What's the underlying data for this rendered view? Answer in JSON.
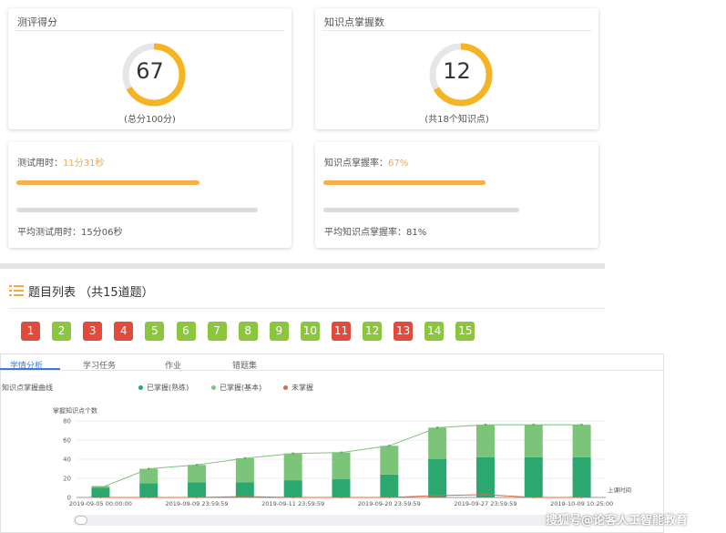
{
  "score_card": {
    "title": "测评得分",
    "value": "67",
    "sub": "(总分100分)",
    "progress": 0.67
  },
  "knowledge_card": {
    "title": "知识点掌握数",
    "value": "12",
    "sub": "(共18个知识点)",
    "progress": 0.667
  },
  "time_card": {
    "label": "测试用时：",
    "value": "11分31秒",
    "progress": 0.76,
    "avg_label": "平均测试用时：15分06秒",
    "avg_progress": 1.0
  },
  "rate_card": {
    "label": "知识点掌握率：",
    "value": "67%",
    "progress": 0.67,
    "avg_label": "平均知识点掌握率：81%",
    "avg_progress": 0.81
  },
  "question_list": {
    "title": "题目列表 （共15道题）",
    "questions": [
      {
        "n": "1",
        "status": "wrong"
      },
      {
        "n": "2",
        "status": "correct"
      },
      {
        "n": "3",
        "status": "wrong"
      },
      {
        "n": "4",
        "status": "wrong"
      },
      {
        "n": "5",
        "status": "correct"
      },
      {
        "n": "6",
        "status": "correct"
      },
      {
        "n": "7",
        "status": "correct"
      },
      {
        "n": "8",
        "status": "correct"
      },
      {
        "n": "9",
        "status": "correct"
      },
      {
        "n": "10",
        "status": "correct"
      },
      {
        "n": "11",
        "status": "wrong"
      },
      {
        "n": "12",
        "status": "correct"
      },
      {
        "n": "13",
        "status": "wrong"
      },
      {
        "n": "14",
        "status": "correct"
      },
      {
        "n": "15",
        "status": "correct"
      }
    ]
  },
  "tabs": [
    "学情分析",
    "学习任务",
    "作业",
    "错题集"
  ],
  "colors": {
    "accent": "#f5b04e",
    "correct": "#8cc63e",
    "wrong": "#e24a3b",
    "mastered_skilled": "#2aa870",
    "mastered_basic": "#7cc47a",
    "not_mastered": "#e0693f"
  },
  "watermark": "搜狐号@论客人工智能教育",
  "chart_data": {
    "type": "bar",
    "title": "知识点掌握曲线",
    "ylabel": "掌握知识点个数",
    "xlabel": "上课时间",
    "ylim": [
      0,
      80
    ],
    "yticks": [
      0,
      20,
      40,
      60,
      80
    ],
    "categories": [
      "2019-09-05 00:00:00",
      "",
      "2019-09-09 23:59:59",
      "",
      "2019-09-11 23:59:59",
      "",
      "2019-09-20 23:59:59",
      "",
      "2019-09-27 23:59:59",
      "",
      "2019-10-09 10:25:00"
    ],
    "series": [
      {
        "name": "已掌握(熟练)",
        "values": [
          10,
          15,
          16,
          16,
          18,
          19,
          24,
          40,
          42,
          42,
          42
        ]
      },
      {
        "name": "已掌握(基本)",
        "values": [
          2,
          15,
          18,
          25,
          28,
          28,
          30,
          33,
          34,
          34,
          34
        ]
      },
      {
        "name": "未掌握",
        "values": [
          0,
          0,
          0,
          1,
          0,
          0,
          0,
          2,
          3,
          0,
          0
        ]
      }
    ],
    "line": [
      10,
      30,
      34,
      41,
      46,
      47,
      54,
      73,
      76,
      76,
      76
    ],
    "legend": "top"
  }
}
